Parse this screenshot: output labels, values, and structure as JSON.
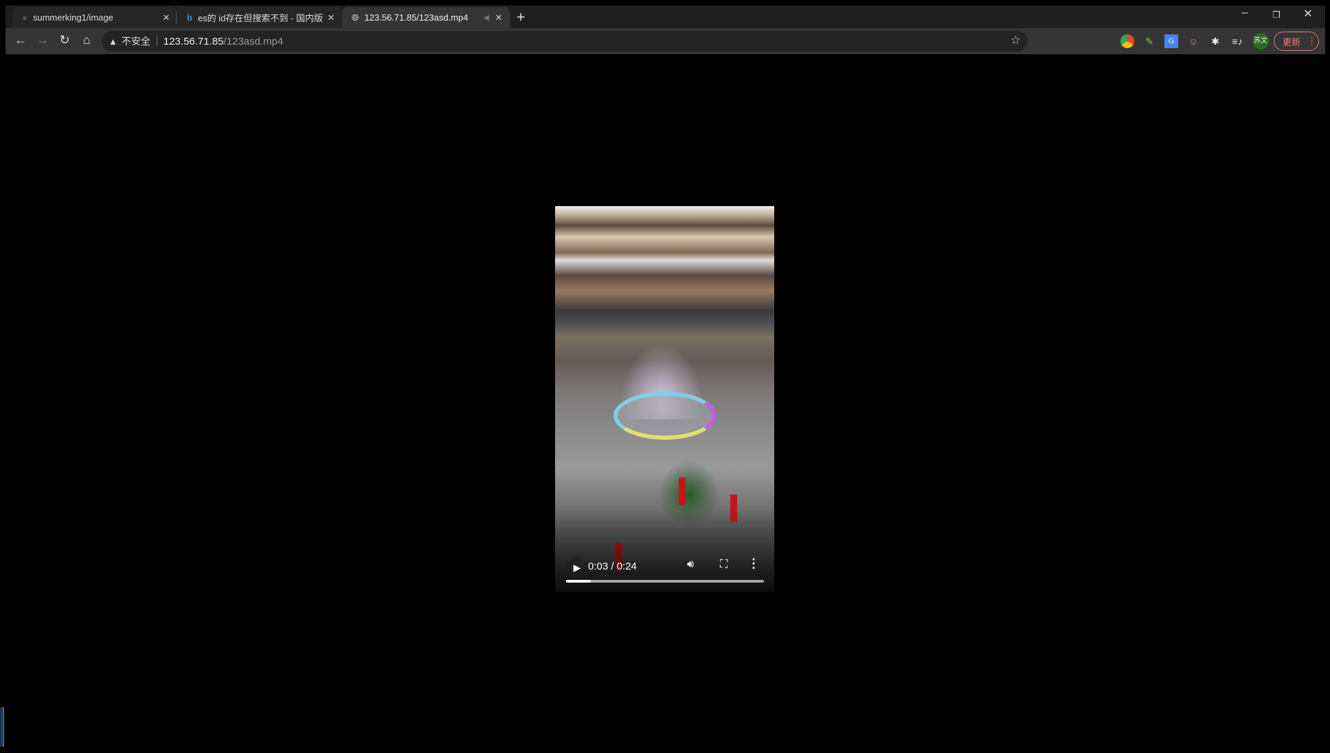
{
  "tabs": [
    {
      "title": "summerking1/image",
      "icon": "github-icon",
      "active": false
    },
    {
      "title": "es的 id存在但搜索不到 - 国内版",
      "icon": "bing-icon",
      "active": false
    },
    {
      "title": "123.56.71.85/123asd.mp4",
      "icon": "globe-icon",
      "active": true,
      "audio": "speaker-muted-icon"
    }
  ],
  "toolbar": {
    "security_label": "不安全",
    "url_host": "123.56.71.85",
    "url_path": "/123asd.mp4",
    "avatar_text": "苏文",
    "update_label": "更新"
  },
  "extensions": [
    "chrome-color-icon",
    "eyedropper-icon",
    "google-translate-icon",
    "face-extension-icon",
    "puzzle-icon",
    "media-control-icon"
  ],
  "video": {
    "current_time": "0:03",
    "duration": "0:24",
    "time_display": "0:03 / 0:24",
    "progress_percent": 12.5
  },
  "colors": {
    "tab_active": "#353535",
    "update_accent": "#e07c70",
    "avatar": "#2c6b1f"
  }
}
